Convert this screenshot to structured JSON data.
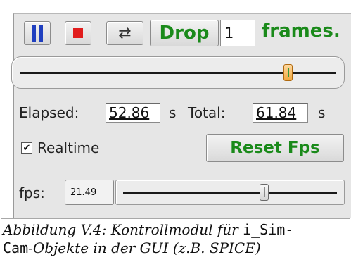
{
  "controls": {
    "drop_label": "Drop",
    "drop_frames_value": "1",
    "frames_label": "frames.",
    "elapsed_label": "Elapsed:",
    "elapsed_value": "52.86",
    "elapsed_unit": "s",
    "total_label": "Total:",
    "total_value": "61.84",
    "total_unit": "s",
    "realtime_label": "Realtime",
    "realtime_checked": true,
    "checkmark": "✔",
    "reset_fps_label": "Reset Fps",
    "fps_label": "fps:",
    "fps_value": "21.49",
    "position_fraction": 0.86,
    "fps_slider_fraction": 0.67
  },
  "icons": {
    "pause": "pause-icon",
    "stop": "stop-icon",
    "loop": "loop-icon",
    "loop_glyph": "⇄"
  },
  "colors": {
    "pause": "#1f3fbf",
    "stop": "#e11d1d",
    "green_text": "#1a8a1a",
    "panel": "#e6e6e6"
  },
  "caption": {
    "prefix": "Abbildung V.4: Kontrollmodul für ",
    "code1": "i_Sim-",
    "code2": "Cam",
    "suffix": "-Objekte in der GUI (z.B. SPICE)"
  }
}
